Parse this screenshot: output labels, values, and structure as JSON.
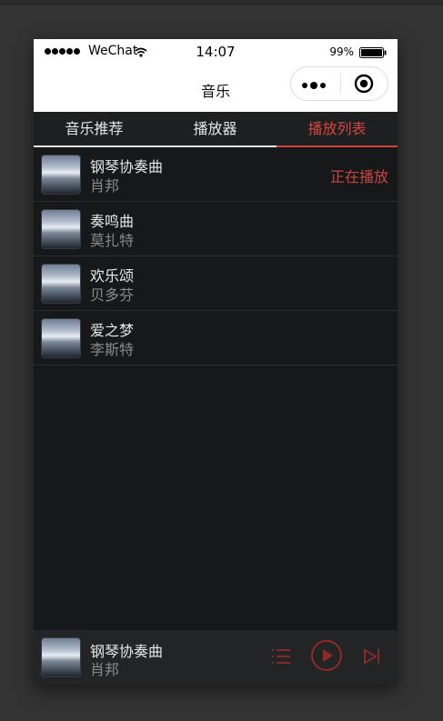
{
  "statusbar": {
    "carrier": "WeChat",
    "time": "14:07",
    "battery": "99%"
  },
  "navbar": {
    "title": "音乐"
  },
  "tabs": [
    {
      "label": "音乐推荐"
    },
    {
      "label": "播放器"
    },
    {
      "label": "播放列表"
    }
  ],
  "playlist": [
    {
      "title": "钢琴协奏曲",
      "artist": "肖邦",
      "status": "正在播放"
    },
    {
      "title": "奏鸣曲",
      "artist": "莫扎特",
      "status": ""
    },
    {
      "title": "欢乐颂",
      "artist": "贝多芬",
      "status": ""
    },
    {
      "title": "爱之梦",
      "artist": "李斯特",
      "status": ""
    }
  ],
  "player": {
    "title": "钢琴协奏曲",
    "artist": "肖邦"
  },
  "colors": {
    "accent": "#c9443e",
    "background": "#17181a"
  },
  "icons": [
    "wifi-icon",
    "battery-icon",
    "more-icon",
    "close-icon",
    "playlist-icon",
    "play-icon",
    "next-icon"
  ]
}
